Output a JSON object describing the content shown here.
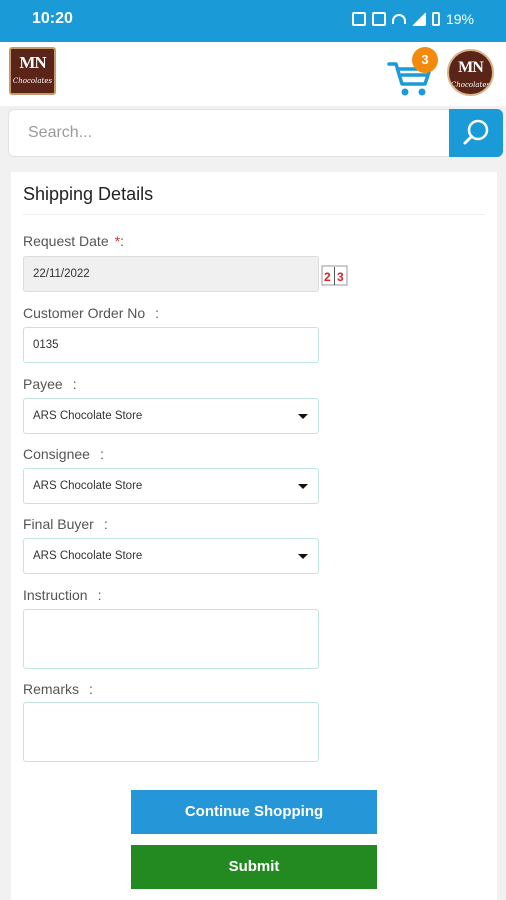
{
  "status_bar": {
    "time": "10:20",
    "battery": "19%"
  },
  "app_bar": {
    "logo_text": "MN",
    "logo_subtext": "Chocolates",
    "cart_icon": "shopping-cart-icon",
    "cart_count": "3"
  },
  "search": {
    "placeholder": "Search...",
    "icon": "search-icon"
  },
  "form": {
    "title": "Shipping Details",
    "request_date": {
      "label": "Request Date",
      "required": "*",
      "colon": ":",
      "value": "22/11/2022"
    },
    "customer_order": {
      "label": "Customer Order No",
      "colon": ":",
      "value": "0135"
    },
    "payee": {
      "label": "Payee",
      "colon": ":",
      "value": "ARS Chocolate Store"
    },
    "consignee": {
      "label": "Consignee",
      "colon": ":",
      "value": "ARS Chocolate Store"
    },
    "final_buyer": {
      "label": "Final Buyer",
      "colon": ":",
      "value": "ARS Chocolate Store"
    },
    "instruction": {
      "label": "Instruction",
      "colon": ":",
      "value": ""
    },
    "remarks": {
      "label": "Remarks",
      "colon": ":",
      "value": ""
    }
  },
  "buttons": {
    "continue": "Continue Shopping",
    "submit": "Submit"
  },
  "colors": {
    "primary": "#1a9bd7",
    "submit": "#238a22",
    "badge": "#f28a0d",
    "brand": "#5a2418"
  }
}
